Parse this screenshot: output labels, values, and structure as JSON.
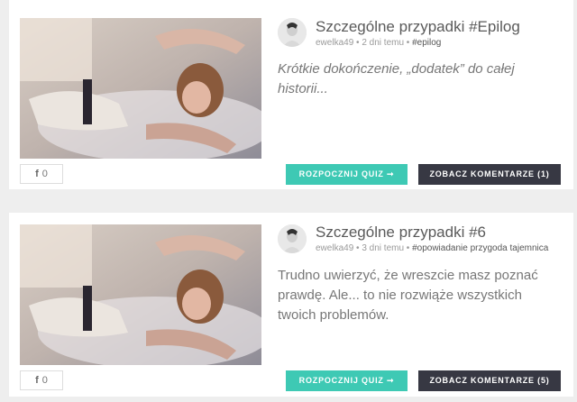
{
  "posts": [
    {
      "title": "Szczególne przypadki #Epilog",
      "author": "ewelka49",
      "sep1": " • ",
      "time": "2 dni temu",
      "sep2": " • ",
      "tag": "#epilog",
      "excerpt": "Krótkie dokończenie, „dodatek” do całej historii...",
      "fb_count": "0",
      "quiz_label": "ROZPOCZNIJ QUIZ ➞",
      "comments_label": "ZOBACZ KOMENTARZE (1)"
    },
    {
      "title": "Szczególne przypadki #6",
      "author": "ewelka49",
      "sep1": " • ",
      "time": "3 dni temu",
      "sep2": " • ",
      "tag": "#opowiadanie przygoda tajemnica",
      "excerpt": "Trudno uwierzyć, że wreszcie masz poznać prawdę. Ale... to nie rozwiąże wszystkich twoich problemów.",
      "fb_count": "0",
      "quiz_label": "ROZPOCZNIJ QUIZ ➞",
      "comments_label": "ZOBACZ KOMENTARZE (5)"
    }
  ],
  "icons": {
    "facebook": "f"
  },
  "colors": {
    "quiz_button": "#3ec9b4",
    "comments_button": "#373843",
    "page_background": "#eeeeee"
  }
}
